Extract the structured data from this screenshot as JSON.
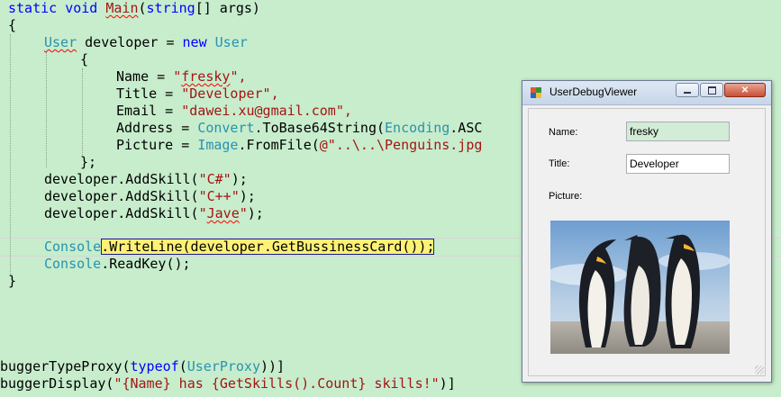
{
  "code": {
    "main_sig": [
      "static",
      " ",
      "void",
      " ",
      "Main",
      "(",
      "string",
      "[] args)"
    ],
    "open_brace": "{",
    "new_user": {
      "t1": "User",
      "t2": " developer = ",
      "t3": "new",
      "t4": " ",
      "t5": "User"
    },
    "init_open": "{",
    "name_line": {
      "prefix": "Name = ",
      "q1": "\"",
      "val": "fresky",
      "q2": "\","
    },
    "title_line": {
      "prefix": "Title = ",
      "val": "\"Developer\","
    },
    "email_line": {
      "prefix": "Email = ",
      "val": "\"dawei.xu@gmail.com\","
    },
    "address_line": {
      "prefix": "Address = ",
      "t1": "Convert",
      "t2": ".ToBase64String(",
      "t3": "Encoding",
      "t4": ".ASC"
    },
    "picture_line": {
      "prefix": "Picture = ",
      "t1": "Image",
      "t2": ".FromFile(",
      "t3": "@\"..\\..\\Penguins.jpg"
    },
    "init_close": "};",
    "skill1": {
      "prefix": "developer.AddSkill(",
      "val": "\"C#\"",
      "suffix": ");"
    },
    "skill2": {
      "prefix": "developer.AddSkill(",
      "val": "\"C++\"",
      "suffix": ");"
    },
    "skill3": {
      "prefix": "developer.AddSkill(",
      "q1": "\"",
      "val": "Jave",
      "q2": "\"",
      "suffix": ");"
    },
    "writeline": {
      "t1": "Console",
      "t2": ".WriteLine(developer.GetBussinessCard());"
    },
    "readkey": {
      "t1": "Console",
      "t2": ".ReadKey();"
    },
    "close_brace": "}",
    "attr1": {
      "p1": "buggerTypeProxy(",
      "kw": "typeof",
      "p2": "(",
      "ty": "UserProxy",
      "p3": "))]"
    },
    "attr2": {
      "p1": "buggerDisplay(",
      "val": "\"{Name} has {GetSkills().Count} skills!\"",
      "p2": ")]"
    }
  },
  "window": {
    "title": "UserDebugViewer",
    "name_label": "Name:",
    "name_value": "fresky",
    "title_label": "Title:",
    "title_value": "Developer",
    "picture_label": "Picture:",
    "minimize_icon": "minimize-icon",
    "maximize_icon": "maximize-icon",
    "close_icon": "close-icon"
  },
  "colors": {
    "editor_bg": "#c7edcc",
    "keyword": "#0000ff",
    "type": "#2b91af",
    "string": "#a31515",
    "highlight": "#fff176"
  }
}
